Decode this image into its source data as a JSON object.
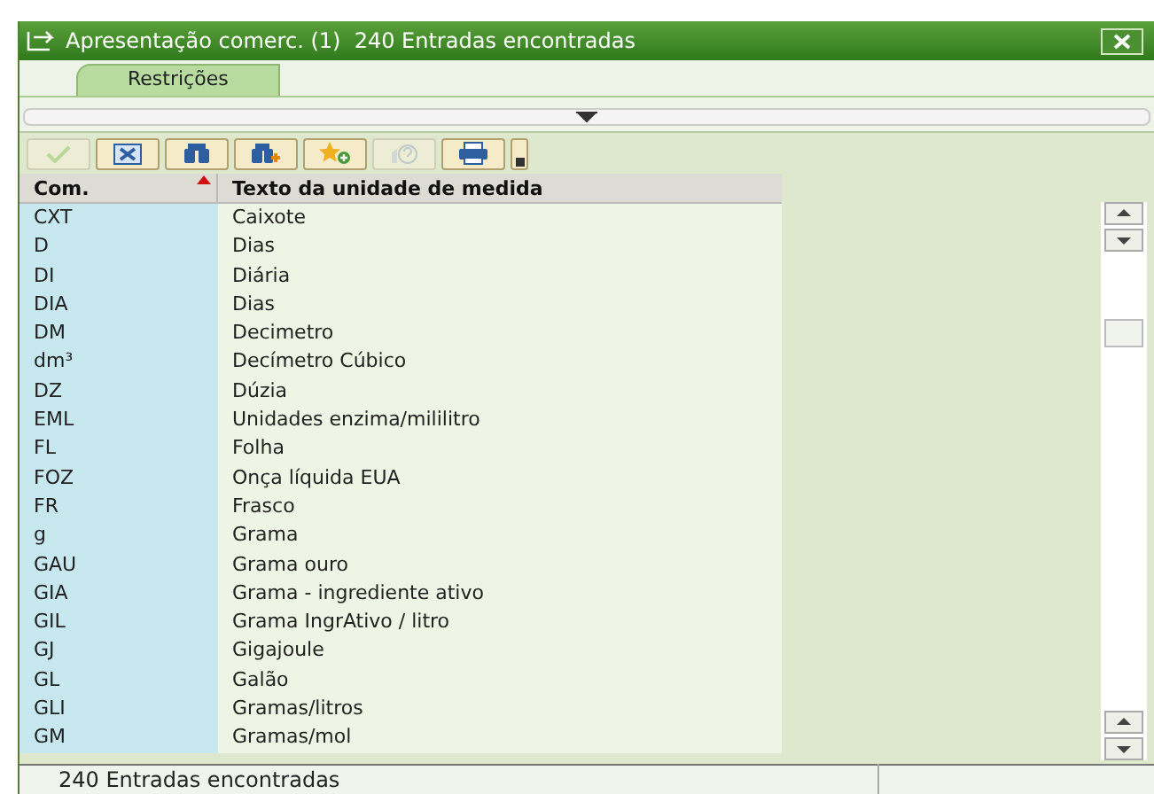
{
  "window": {
    "title": "Apresentação comerc. (1)  240 Entradas encontradas"
  },
  "tabs": [
    {
      "label": "Restrições",
      "selected": true
    }
  ],
  "toolbar": [
    {
      "kind": "check",
      "disabled": true
    },
    {
      "kind": "cancel",
      "disabled": false
    },
    {
      "kind": "find",
      "disabled": false
    },
    {
      "kind": "find-next",
      "disabled": false
    },
    {
      "kind": "favorite",
      "disabled": false
    },
    {
      "kind": "help",
      "disabled": true
    },
    {
      "kind": "print",
      "disabled": false
    },
    {
      "kind": "more",
      "disabled": false
    }
  ],
  "table": {
    "columns": [
      {
        "label": "Com.",
        "sorted": true
      },
      {
        "label": "Texto da unidade de medida",
        "sorted": false
      }
    ],
    "rows": [
      [
        "CXT",
        "Caixote"
      ],
      [
        "D",
        "Dias"
      ],
      [
        "DI",
        "Diária"
      ],
      [
        "DIA",
        "Dias"
      ],
      [
        "DM",
        "Decimetro"
      ],
      [
        "dm³",
        "Decímetro Cúbico"
      ],
      [
        "DZ",
        "Dúzia"
      ],
      [
        "EML",
        "Unidades enzima/mililitro"
      ],
      [
        "FL",
        "Folha"
      ],
      [
        "FOZ",
        "Onça líquida EUA"
      ],
      [
        "FR",
        "Frasco"
      ],
      [
        "g",
        "Grama"
      ],
      [
        "GAU",
        "Grama ouro"
      ],
      [
        "GIA",
        "Grama - ingrediente ativo"
      ],
      [
        "GIL",
        "Grama IngrAtivo / litro"
      ],
      [
        "GJ",
        "Gigajoule"
      ],
      [
        "GL",
        "Galão"
      ],
      [
        "GLI",
        "Gramas/litros"
      ],
      [
        "GM",
        "Gramas/mol"
      ]
    ]
  },
  "status_bar": "240 Entradas encontradas"
}
